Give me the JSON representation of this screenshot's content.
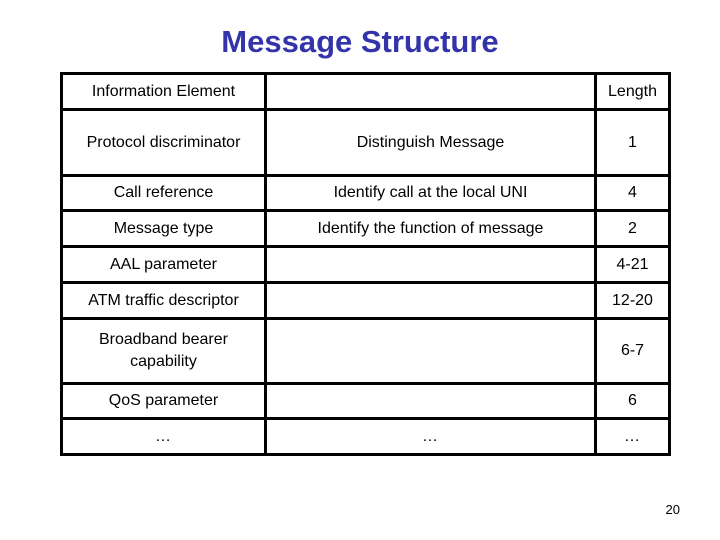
{
  "slide": {
    "title": "Message Structure",
    "page_number": "20",
    "accent_color": "#3333aa"
  },
  "table": {
    "header": {
      "col1": "Information Element",
      "col2": "",
      "col3": "Length"
    },
    "rows": [
      {
        "element": "Protocol discriminator",
        "description": "Distinguish Message",
        "length": "1"
      },
      {
        "element": "Call reference",
        "description": "Identify call at the local UNI",
        "length": "4"
      },
      {
        "element": "Message type",
        "description": "Identify the function of message",
        "length": "2"
      },
      {
        "element": "AAL parameter",
        "description": "",
        "length": "4-21"
      },
      {
        "element": "ATM traffic descriptor",
        "description": "",
        "length": "12-20"
      },
      {
        "element": "Broadband bearer capability",
        "description": "",
        "length": "6-7"
      },
      {
        "element": "QoS parameter",
        "description": "",
        "length": "6"
      },
      {
        "element": "…",
        "description": "…",
        "length": "…"
      }
    ]
  }
}
